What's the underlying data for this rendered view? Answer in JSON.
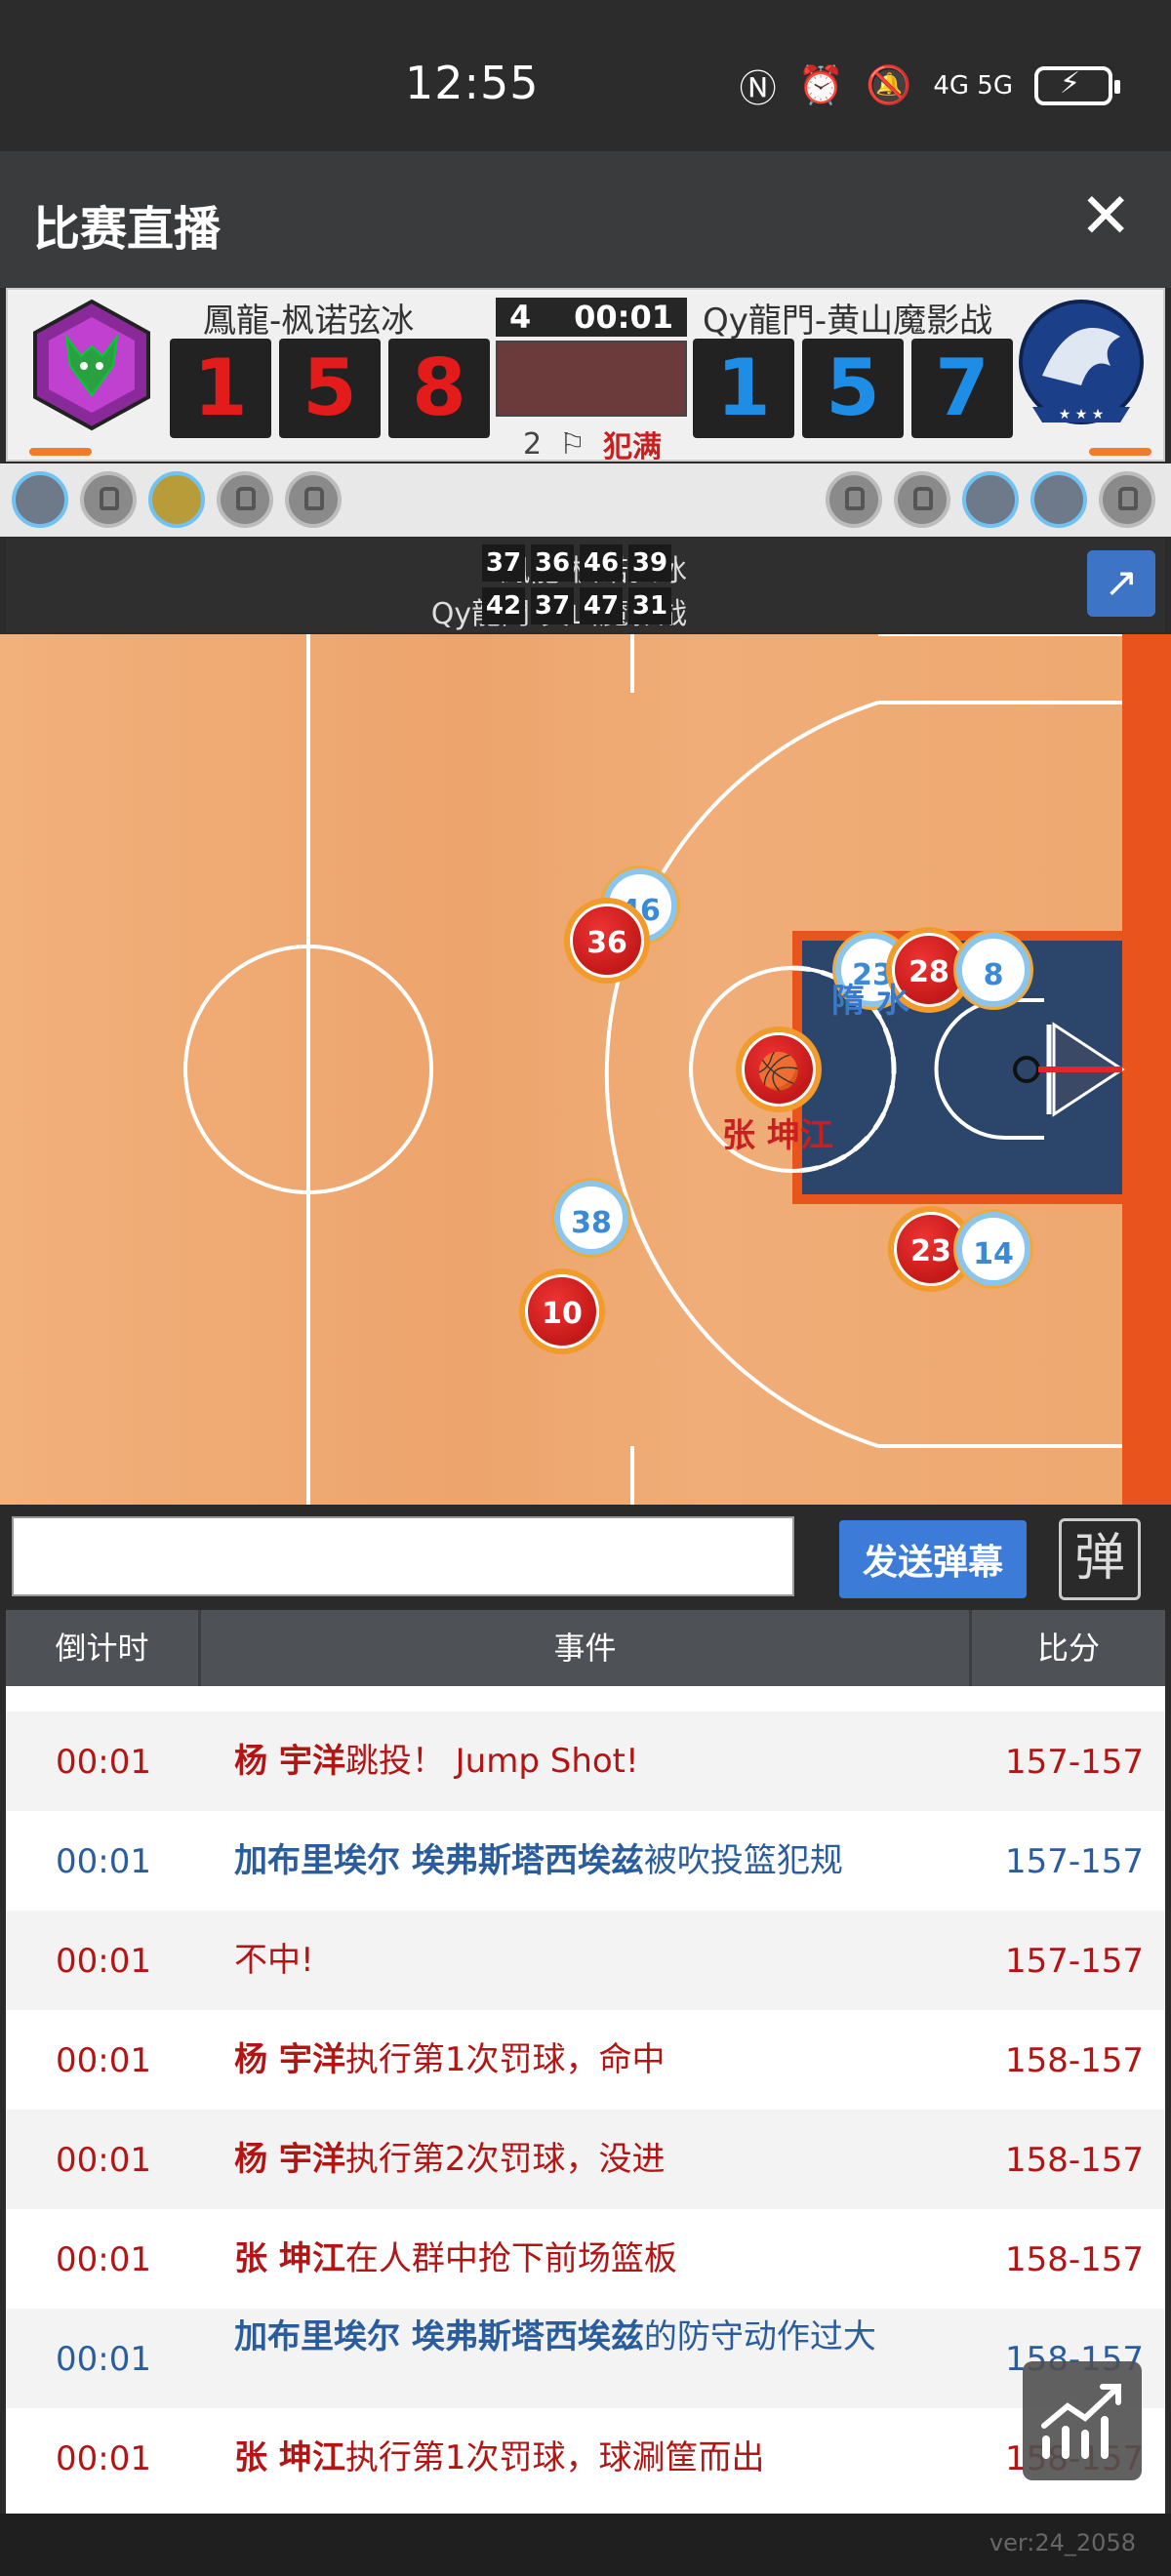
{
  "status": {
    "time": "12:55",
    "network": "4G 5G",
    "icons": [
      "nfc-icon",
      "alarm-icon",
      "mute-icon",
      "signal-icon",
      "battery-charging-icon"
    ]
  },
  "header": {
    "title": "比赛直播",
    "close_symbol": "✕"
  },
  "scoreboard": {
    "home_name": "鳳龍-枫诺弦冰",
    "away_name": "Qy龍門-黄山魔影战",
    "home_digits": [
      "1",
      "5",
      "8"
    ],
    "away_digits": [
      "1",
      "5",
      "7"
    ],
    "quarter": "4",
    "clock": "00:01",
    "fouls": "2",
    "foul_label": "犯满",
    "home_color": "#e31b1b",
    "away_color": "#1e8de6"
  },
  "quarters": {
    "home_label": "鳳龍-枫诺弦冰",
    "away_label": "Qy龍門-黄山魔影战",
    "home_scores": [
      "37",
      "36",
      "46",
      "39"
    ],
    "away_scores": [
      "42",
      "37",
      "47",
      "31"
    ]
  },
  "court": {
    "players": [
      {
        "num": "46",
        "side": "away"
      },
      {
        "num": "36",
        "side": "home"
      },
      {
        "num": "23",
        "side": "away"
      },
      {
        "num": "28",
        "side": "home"
      },
      {
        "num": "8",
        "side": "away"
      },
      {
        "num": "38",
        "side": "away"
      },
      {
        "num": "10",
        "side": "home"
      },
      {
        "num": "23",
        "side": "home"
      },
      {
        "num": "14",
        "side": "away"
      }
    ],
    "labels": {
      "away_player": "隋 水",
      "home_player": "张 坤江"
    }
  },
  "danmu": {
    "placeholder": "",
    "send_label": "发送弹幕",
    "toggle_label": "弹"
  },
  "log": {
    "headers": [
      "倒计时",
      "事件",
      "比分"
    ],
    "rows": [
      {
        "time": "00:01",
        "name": "杨 宇洋",
        "text": "跳投！ Jump Shot!",
        "score": "157-157",
        "team": "home"
      },
      {
        "time": "00:01",
        "name": "加布里埃尔 埃弗斯塔西埃兹",
        "text": "被吹投篮犯规",
        "score": "157-157",
        "team": "away"
      },
      {
        "time": "00:01",
        "name": "",
        "text": "不中!",
        "score": "157-157",
        "team": "home"
      },
      {
        "time": "00:01",
        "name": "杨 宇洋",
        "text": "执行第1次罚球，命中",
        "score": "158-157",
        "team": "home"
      },
      {
        "time": "00:01",
        "name": "杨 宇洋",
        "text": "执行第2次罚球，没进",
        "score": "158-157",
        "team": "home"
      },
      {
        "time": "00:01",
        "name": "张 坤江",
        "text": "在人群中抢下前场篮板",
        "score": "158-157",
        "team": "home"
      },
      {
        "time": "00:01",
        "name": "加布里埃尔 埃弗斯塔西埃兹",
        "text": "的防守动作过大",
        "score": "158-157",
        "team": "away"
      },
      {
        "time": "00:01",
        "name": "张 坤江",
        "text": "执行第1次罚球，球涮筐而出",
        "score": "158-157",
        "team": "home"
      }
    ]
  },
  "footer": {
    "version": "ver:24_2058"
  }
}
